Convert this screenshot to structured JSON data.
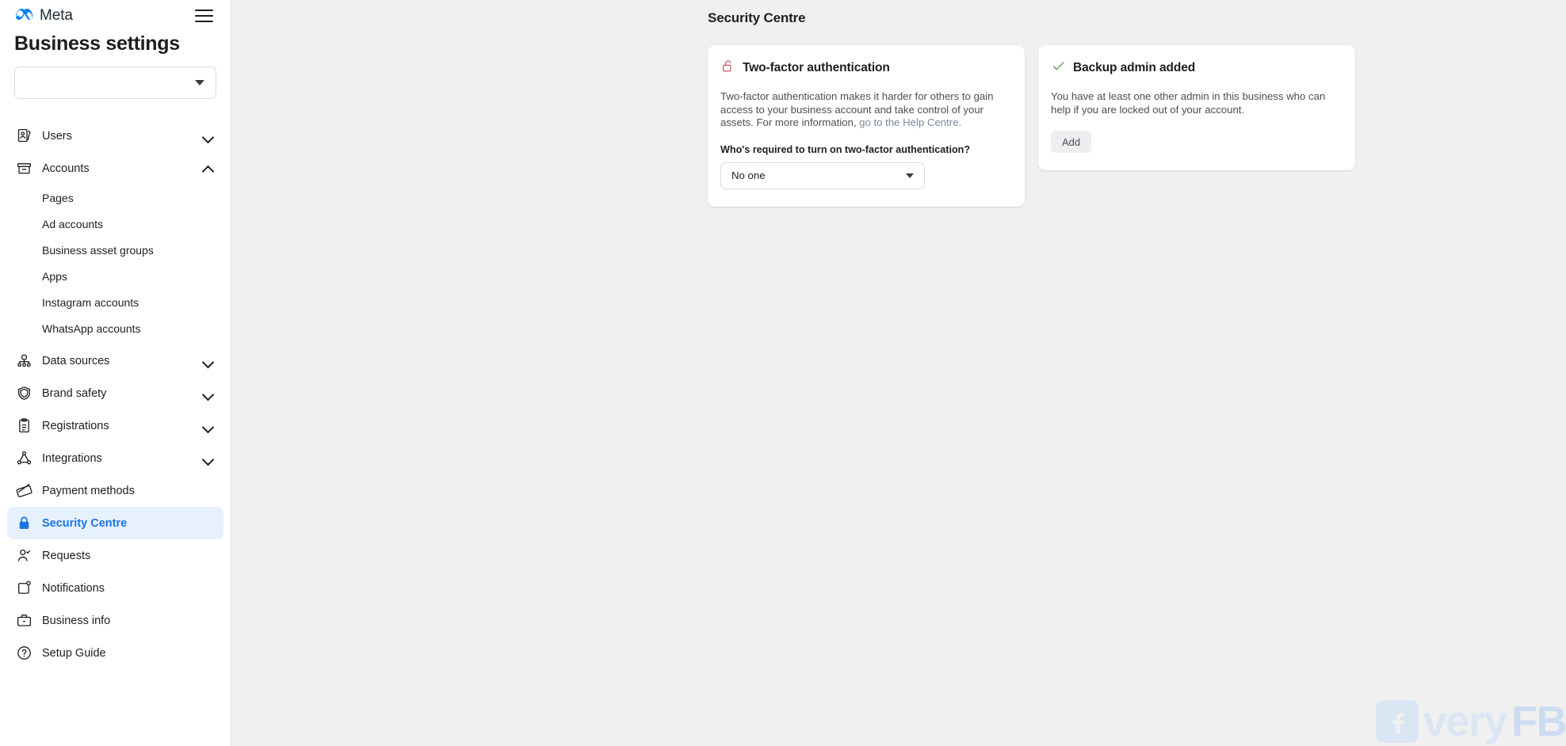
{
  "brand": {
    "name": "Meta",
    "logo_icon": "meta-infinity-icon"
  },
  "sidebar": {
    "menu_icon": "hamburger-menu-icon",
    "title": "Business settings",
    "business_selector": {
      "value": "",
      "icon": "chevron-down-icon"
    },
    "items": [
      {
        "label": "Users",
        "icon": "users-icon",
        "expandable": true,
        "expanded": false
      },
      {
        "label": "Accounts",
        "icon": "accounts-box-icon",
        "expandable": true,
        "expanded": true
      },
      {
        "label": "Data sources",
        "icon": "data-sources-icon",
        "expandable": true,
        "expanded": false
      },
      {
        "label": "Brand safety",
        "icon": "shield-icon",
        "expandable": true,
        "expanded": false
      },
      {
        "label": "Registrations",
        "icon": "clipboard-icon",
        "expandable": true,
        "expanded": false
      },
      {
        "label": "Integrations",
        "icon": "integrations-node-icon",
        "expandable": true,
        "expanded": false
      },
      {
        "label": "Payment methods",
        "icon": "credit-card-icon",
        "expandable": false,
        "expanded": false
      },
      {
        "label": "Security Centre",
        "icon": "lock-icon",
        "expandable": false,
        "expanded": false,
        "active": true
      },
      {
        "label": "Requests",
        "icon": "person-check-icon",
        "expandable": false,
        "expanded": false
      },
      {
        "label": "Notifications",
        "icon": "notification-bell-icon",
        "expandable": false,
        "expanded": false
      },
      {
        "label": "Business info",
        "icon": "briefcase-icon",
        "expandable": false,
        "expanded": false
      },
      {
        "label": "Setup Guide",
        "icon": "question-circle-icon",
        "expandable": false,
        "expanded": false
      }
    ],
    "accounts_subitems": [
      {
        "label": "Pages"
      },
      {
        "label": "Ad accounts"
      },
      {
        "label": "Business asset groups"
      },
      {
        "label": "Apps"
      },
      {
        "label": "Instagram accounts"
      },
      {
        "label": "WhatsApp accounts"
      }
    ]
  },
  "main": {
    "page_title": "Security Centre",
    "cards": [
      {
        "id": "two-factor-authentication",
        "icon": "unlock-icon",
        "icon_color": "#c9556a",
        "title": "Two-factor authentication",
        "body_text": "Two-factor authentication makes it harder for others to gain access to your business account and take control of your assets. For more information, ",
        "body_link": "go to the Help Centre.",
        "field_label": "Who's required to turn on two-factor authentication?",
        "select_value": "No one",
        "select_icon": "chevron-down-icon"
      },
      {
        "id": "backup-admin-added",
        "icon": "check-icon",
        "icon_color": "#6b9b6b",
        "title": "Backup admin added",
        "body_text": "You have at least one other admin in this business who can help if you are locked out of your account.",
        "button_label": "Add"
      }
    ]
  },
  "watermark": {
    "icon": "facebook-f-icon",
    "text_part1": "very",
    "text_part2": "FB"
  },
  "colors": {
    "accent_blue": "#1b74e4",
    "active_bg": "#e7f0fd",
    "page_bg": "#f0f0f0",
    "card_bg": "#ffffff",
    "lock_red": "#c9556a",
    "check_green": "#6b9b6b"
  }
}
